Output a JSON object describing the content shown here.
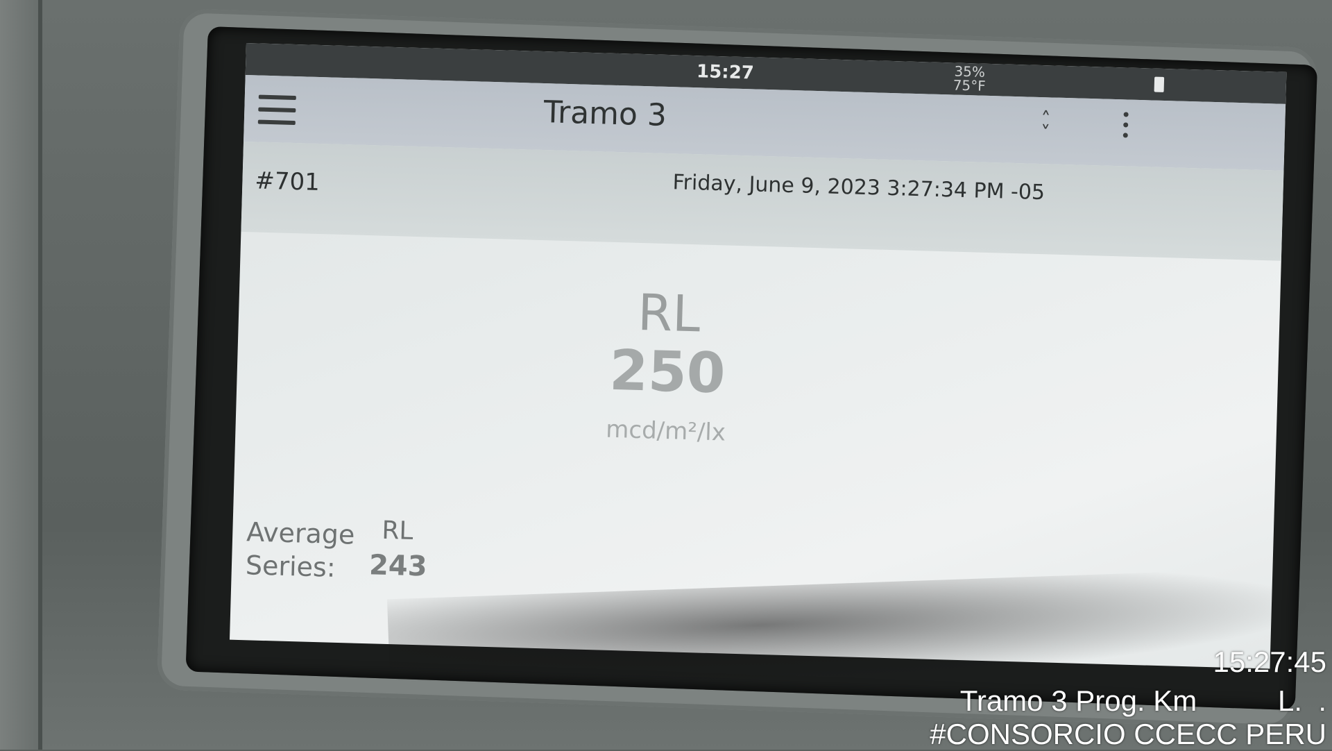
{
  "status_bar": {
    "time": "15:27",
    "temperature": "35%\n75°F"
  },
  "app_bar": {
    "title": "Tramo 3",
    "chevron_icon": "chevron-updown-icon",
    "menu_icon": "hamburger-menu-icon",
    "overflow_icon": "more-vert-icon"
  },
  "record": {
    "id": "#701",
    "timestamp": "Friday, June 9, 2023 3:27:34 PM -05"
  },
  "measurement": {
    "label": "RL",
    "value": "250",
    "unit": "mcd/m²/lx"
  },
  "average_series": {
    "label_line1": "Average",
    "label_line2": "Series:",
    "metric": "RL",
    "value": "243"
  },
  "photo_overlay": {
    "time": "15:27:45",
    "location": "Tramo 3 Prog. Km          L.  .",
    "tag": "#CONSORCIO CCECC PERU"
  }
}
